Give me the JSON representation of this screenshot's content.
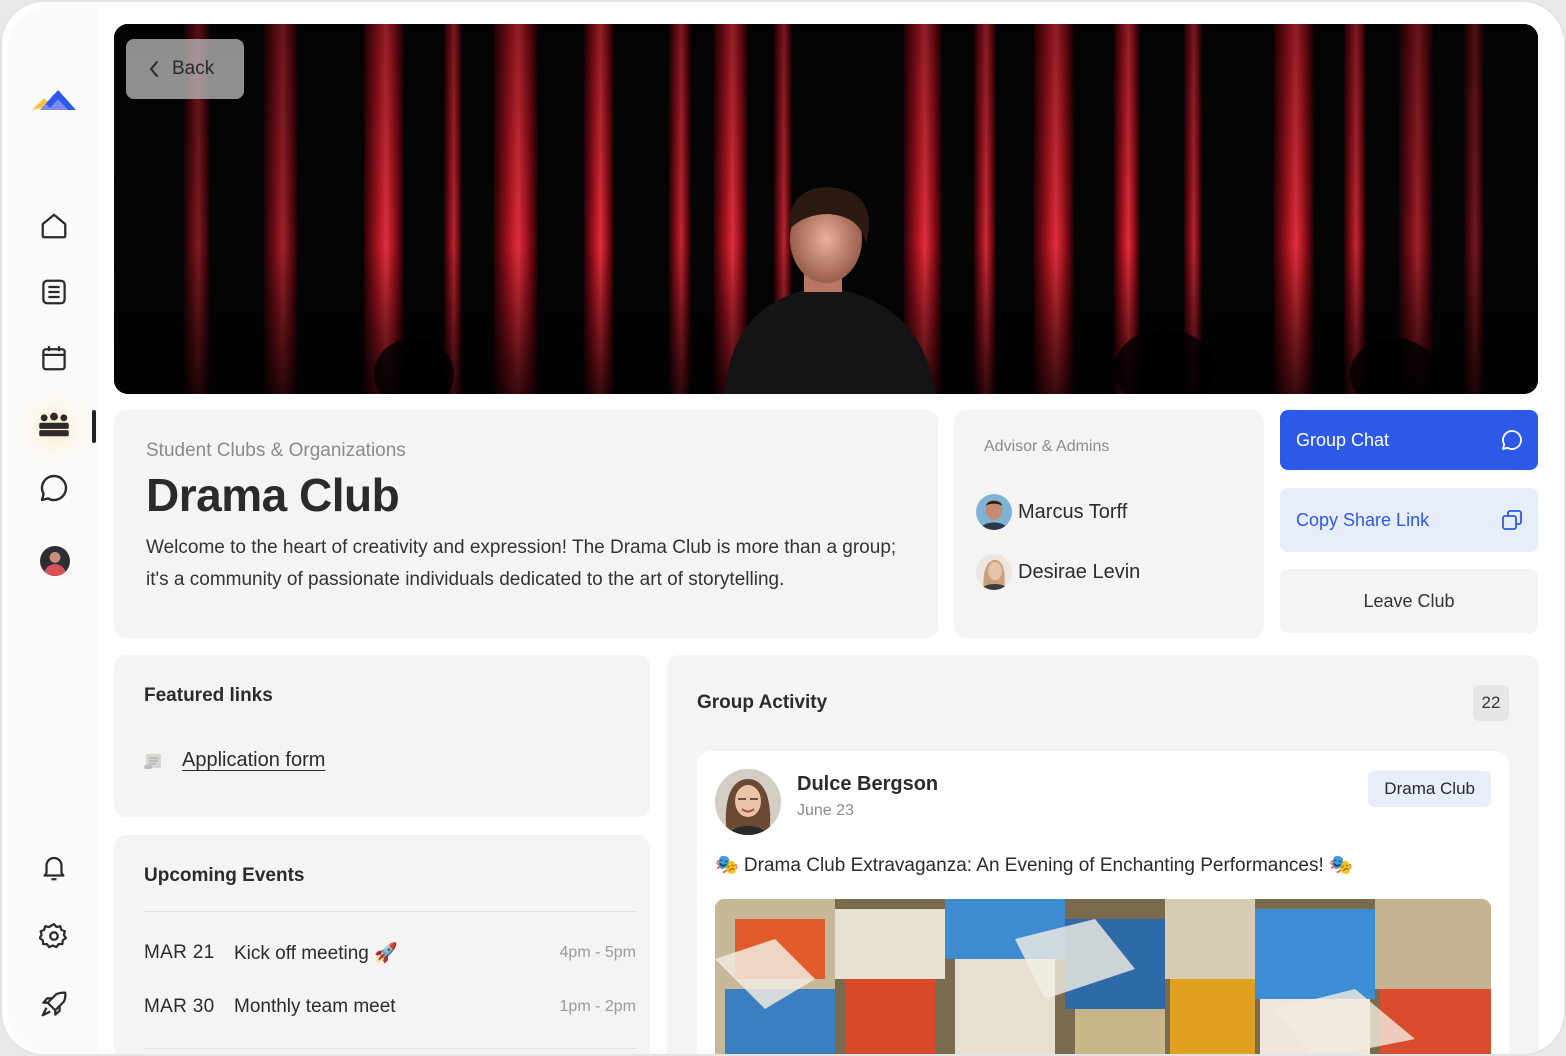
{
  "nav": {
    "items": [
      {
        "icon": "home-icon"
      },
      {
        "icon": "document-icon"
      },
      {
        "icon": "calendar-icon"
      },
      {
        "icon": "groups-icon",
        "active": true
      },
      {
        "icon": "chat-icon"
      },
      {
        "icon": "profile-avatar"
      }
    ],
    "bottom": [
      {
        "icon": "bell-icon"
      },
      {
        "icon": "gear-icon"
      },
      {
        "icon": "rocket-icon"
      }
    ]
  },
  "hero": {
    "back_label": "Back"
  },
  "club": {
    "category": "Student Clubs & Organizations",
    "name": "Drama Club",
    "description": "Welcome to the heart of creativity and expression! The Drama Club is more than a group; it's a community of passionate individuals dedicated to the art of storytelling."
  },
  "admins": {
    "title": "Advisor & Admins",
    "people": [
      {
        "name": "Marcus Torff"
      },
      {
        "name": "Desirae Levin"
      }
    ]
  },
  "actions": {
    "group_chat": "Group Chat",
    "copy_link": "Copy Share Link",
    "leave": "Leave Club"
  },
  "featured": {
    "title": "Featured links",
    "links": [
      {
        "label": "Application form"
      }
    ]
  },
  "events": {
    "title": "Upcoming Events",
    "items": [
      {
        "date": "MAR 21",
        "name": "Kick off meeting 🚀",
        "time": "4pm - 5pm"
      },
      {
        "date": "MAR 30",
        "name": "Monthly team meet",
        "time": "1pm - 2pm"
      }
    ]
  },
  "activity": {
    "title": "Group Activity",
    "count": "22",
    "post": {
      "author": "Dulce Bergson",
      "date": "June 23",
      "tag": "Drama Club",
      "text": "🎭 Drama Club Extravaganza: An Evening of Enchanting Performances! 🎭"
    }
  },
  "colors": {
    "accent": "#2d59e8",
    "accent_light": "#e8edfc",
    "card_bg": "#f4f4f4",
    "curtain_red": "#b01421"
  }
}
